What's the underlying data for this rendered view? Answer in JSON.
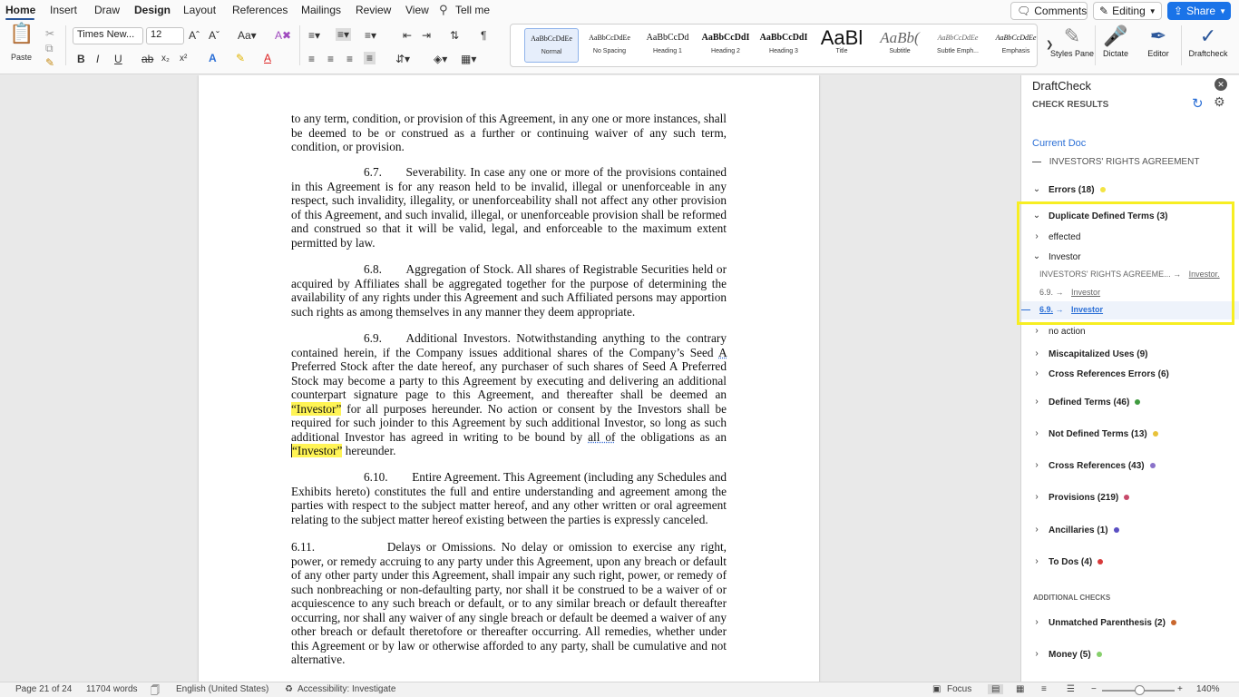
{
  "tabs": [
    "Home",
    "Insert",
    "Draw",
    "Design",
    "Layout",
    "References",
    "Mailings",
    "Review",
    "View"
  ],
  "tell_me": "Tell me",
  "top_buttons": {
    "comments": "Comments",
    "editing": "Editing",
    "share": "Share"
  },
  "ribbon": {
    "paste": "Paste",
    "font_name": "Times New...",
    "font_size": "12",
    "styles": [
      {
        "preview": "AaBbCcDdEe",
        "label": "Normal"
      },
      {
        "preview": "AaBbCcDdEe",
        "label": "No Spacing"
      },
      {
        "preview": "AaBbCcDd",
        "label": "Heading 1"
      },
      {
        "preview": "AaBbCcDdI",
        "label": "Heading 2"
      },
      {
        "preview": "AaBbCcDdI",
        "label": "Heading 3"
      },
      {
        "preview": "AaBl",
        "label": "Title"
      },
      {
        "preview": "AaBb(",
        "label": "Subtitle"
      },
      {
        "preview": "AaBbCcDdEe",
        "label": "Subtle Emph..."
      },
      {
        "preview": "AaBbCcDdEe",
        "label": "Emphasis"
      }
    ],
    "styles_pane": "Styles Pane",
    "dictate": "Dictate",
    "editor": "Editor",
    "draftcheck": "Draftcheck"
  },
  "document": {
    "p1": "to any term, condition, or provision of this Agreement, in any one or more instances, shall be deemed to be or construed as a further or continuing waiver of any such term, condition, or provision.",
    "p2": "6.7.  Severability. In case any one or more of the provisions contained in this Agreement is for any reason held to be invalid, illegal or unenforceable in any respect, such invalidity, illegality, or unenforceability shall not affect any other provision of this Agreement, and such invalid, illegal, or unenforceable provision shall be reformed and construed so that it will be valid, legal, and enforceable to the maximum extent permitted by law.",
    "p3": "6.8.  Aggregation of Stock. All shares of Registrable Securities held or acquired by Affiliates shall be aggregated together for the purpose of determining the availability of any rights under this Agreement and such Affiliated persons may apportion such rights as among themselves in any manner they deem appropriate.",
    "p4_a": "6.9.  Additional Investors. Notwithstanding anything to the contrary contained herein, if the Company issues additional shares of the Company’s Seed",
    "p4_b": "A",
    "p4_c": "Preferred Stock after the date hereof, any purchaser of such shares of Seed A Preferred Stock may become a party to this Agreement by executing and delivering an additional counterpart signature page to this Agreement, and thereafter shall be deemed an",
    "p4_d": "“Investor”",
    "p4_e": "for all purposes hereunder.  No action or consent by the Investors shall be required for such joinder to this Agreement by such additional Investor, so long as such additional Investor has agreed in writing to be bound by",
    "p4_f": "all of",
    "p4_g": "the obligations as an",
    "p4_h": "“Investor”",
    "p4_i": "hereunder.",
    "p5": "6.10.  Entire Agreement. This Agreement (including any Schedules and Exhibits hereto) constitutes the full and entire understanding and agreement among the parties with respect to the subject matter hereof, and any other written or oral agreement relating to the subject matter hereof existing between the parties is expressly canceled.",
    "p6": "6.11.      Delays or Omissions. No delay or omission to exercise any right, power, or remedy accruing to any party under this Agreement, upon any breach or default of any other party under this Agreement, shall impair any such right, power, or remedy of such nonbreaching or non-defaulting party, nor shall it be construed to be a waiver of or acquiescence to any such breach or default, or to any similar breach or default thereafter occurring, nor shall any waiver of any single breach or default be deemed a waiver of any other breach or default theretofore or thereafter occurring. All  remedies,  whether  under this Agreement or by law or otherwise afforded to any party, shall be cumulative and not alternative."
  },
  "panel": {
    "title": "DraftCheck",
    "subtitle": "CHECK RESULTS",
    "current_doc": "Current Doc",
    "doc_name": "INVESTORS' RIGHTS AGREEMENT",
    "errors": "Errors (18)",
    "duplicate": "Duplicate Defined Terms (3)",
    "effected": "effected",
    "investor": "Investor",
    "occ1_src": "INVESTORS' RIGHTS AGREEME...",
    "occ1_term": "Investor.",
    "occ2_src": "6.9.",
    "occ2_term": "Investor",
    "occ3_src": "6.9.",
    "occ3_term": "Investor",
    "arrow": "→",
    "no_action": "no action",
    "miscap": "Miscapitalized Uses (9)",
    "crossref_err": "Cross References Errors (6)",
    "groups": [
      {
        "label": "Defined Terms (46)",
        "color": "#3f9a3f"
      },
      {
        "label": "Not Defined Terms (13)",
        "color": "#e8c23a"
      },
      {
        "label": "Cross References (43)",
        "color": "#8a72c9"
      },
      {
        "label": "Provisions (219)",
        "color": "#c74a6a"
      },
      {
        "label": "Ancillaries (1)",
        "color": "#5a4fc2"
      },
      {
        "label": "To Dos (4)",
        "color": "#d83a3a"
      }
    ],
    "additional": "ADDITIONAL CHECKS",
    "extra": [
      {
        "label": "Unmatched Parenthesis (2)",
        "color": "#c9672e"
      },
      {
        "label": "Money (5)",
        "color": "#86cf6b"
      }
    ],
    "errors_color": "#f3e443"
  },
  "status": {
    "page": "Page 21 of 24",
    "words": "11704 words",
    "language": "English (United States)",
    "accessibility": "Accessibility: Investigate",
    "focus": "Focus",
    "zoom": "140%"
  }
}
